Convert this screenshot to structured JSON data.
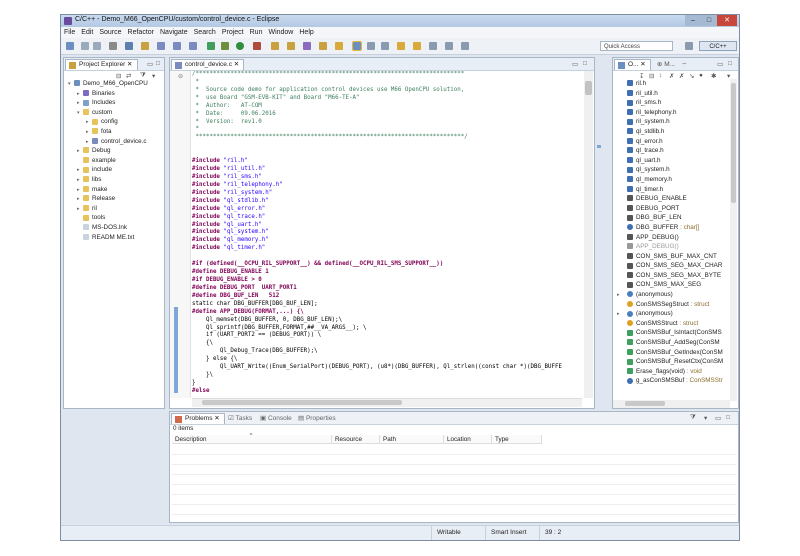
{
  "window": {
    "title": "C/C++ - Demo_M66_OpenCPU/custom/control_device.c - Eclipse"
  },
  "menu": [
    "File",
    "Edit",
    "Source",
    "Refactor",
    "Navigate",
    "Search",
    "Project",
    "Run",
    "Window",
    "Help"
  ],
  "toolbar": {
    "quick_access_placeholder": "Quick Access",
    "perspective_label": "C/C++"
  },
  "project_explorer": {
    "tab_label": "Project Explorer",
    "items": [
      {
        "label": "Demo_M66_OpenCPU",
        "depth": 0,
        "arrow": "▾",
        "icon": "project-icon",
        "color": "#6b8fbf"
      },
      {
        "label": "Binaries",
        "depth": 1,
        "arrow": "▸",
        "icon": "binaries-icon",
        "color": "#7c6bbf"
      },
      {
        "label": "Includes",
        "depth": 1,
        "arrow": "▸",
        "icon": "includes-icon",
        "color": "#7ea1c9"
      },
      {
        "label": "custom",
        "depth": 1,
        "arrow": "▾",
        "icon": "folder-icon",
        "color": "#e8c25a"
      },
      {
        "label": "config",
        "depth": 2,
        "arrow": "▸",
        "icon": "folder-icon",
        "color": "#e8c25a"
      },
      {
        "label": "fota",
        "depth": 2,
        "arrow": "▸",
        "icon": "folder-icon",
        "color": "#e8c25a"
      },
      {
        "label": "control_device.c",
        "depth": 2,
        "arrow": "▸",
        "icon": "c-file-icon",
        "color": "#7c8bbf"
      },
      {
        "label": "Debug",
        "depth": 1,
        "arrow": "▸",
        "icon": "folder-icon",
        "color": "#e8c25a"
      },
      {
        "label": "example",
        "depth": 1,
        "arrow": "",
        "icon": "folder-icon",
        "color": "#e8c25a"
      },
      {
        "label": "include",
        "depth": 1,
        "arrow": "▸",
        "icon": "folder-icon",
        "color": "#e8c25a"
      },
      {
        "label": "libs",
        "depth": 1,
        "arrow": "▸",
        "icon": "folder-icon",
        "color": "#e8c25a"
      },
      {
        "label": "make",
        "depth": 1,
        "arrow": "▸",
        "icon": "folder-icon",
        "color": "#e8c25a"
      },
      {
        "label": "Release",
        "depth": 1,
        "arrow": "▸",
        "icon": "folder-icon",
        "color": "#e8c25a"
      },
      {
        "label": "ril",
        "depth": 1,
        "arrow": "▸",
        "icon": "folder-icon",
        "color": "#e8c25a"
      },
      {
        "label": "tools",
        "depth": 1,
        "arrow": "",
        "icon": "folder-icon",
        "color": "#e8c25a"
      },
      {
        "label": "MS-DOS.lnk",
        "depth": 1,
        "arrow": "",
        "icon": "file-icon",
        "color": "#c9d3df"
      },
      {
        "label": "READM ME.txt",
        "depth": 1,
        "arrow": "",
        "icon": "text-file-icon",
        "color": "#c9d3df"
      }
    ]
  },
  "editor": {
    "tab_label": "control_device.c",
    "lines": [
      {
        "t": "cmt",
        "s": "/*****************************************************************************"
      },
      {
        "t": "cmt",
        "s": " *"
      },
      {
        "t": "cmt",
        "s": " *  Source code demo for application control devices use M66 OpenCPU solution,"
      },
      {
        "t": "cmt",
        "s": " *  use Board \"GSM-EVB-KIT\" and Board \"M66-TE-A\""
      },
      {
        "t": "cmt",
        "s": " *  Author:   AT-COM"
      },
      {
        "t": "cmt",
        "s": " *  Date:     09.06.2016"
      },
      {
        "t": "cmt",
        "s": " *  Version:  rev1.0"
      },
      {
        "t": "cmt",
        "s": " *"
      },
      {
        "t": "cmt",
        "s": " *****************************************************************************/"
      },
      {
        "t": "txt",
        "s": ""
      },
      {
        "t": "txt",
        "s": ""
      },
      {
        "t": "inc",
        "p": "#include ",
        "s": "\"ril.h\""
      },
      {
        "t": "inc",
        "p": "#include ",
        "s": "\"ril_util.h\""
      },
      {
        "t": "inc",
        "p": "#include ",
        "s": "\"ril_sms.h\""
      },
      {
        "t": "inc",
        "p": "#include ",
        "s": "\"ril_telephony.h\""
      },
      {
        "t": "inc",
        "p": "#include ",
        "s": "\"ril_system.h\""
      },
      {
        "t": "inc",
        "p": "#include ",
        "s": "\"ql_stdlib.h\""
      },
      {
        "t": "inc",
        "p": "#include ",
        "s": "\"ql_error.h\""
      },
      {
        "t": "inc",
        "p": "#include ",
        "s": "\"ql_trace.h\""
      },
      {
        "t": "inc",
        "p": "#include ",
        "s": "\"ql_uart.h\""
      },
      {
        "t": "inc",
        "p": "#include ",
        "s": "\"ql_system.h\""
      },
      {
        "t": "inc",
        "p": "#include ",
        "s": "\"ql_memory.h\""
      },
      {
        "t": "inc",
        "p": "#include ",
        "s": "\"ql_timer.h\""
      },
      {
        "t": "txt",
        "s": ""
      },
      {
        "t": "pre",
        "s": "#if (defined(__OCPU_RIL_SUPPORT__) && defined(__OCPU_RIL_SMS_SUPPORT__))"
      },
      {
        "t": "pre",
        "s": "#define DEBUG_ENABLE 1"
      },
      {
        "t": "pre",
        "s": "#if DEBUG_ENABLE > 0"
      },
      {
        "t": "pre",
        "s": "#define DEBUG_PORT  UART_PORT1"
      },
      {
        "t": "pre",
        "s": "#define DBG_BUF_LEN   512"
      },
      {
        "t": "txt",
        "s": "static char DBG_BUFFER[DBG_BUF_LEN];"
      },
      {
        "t": "pre",
        "s": "#define APP_DEBUG(FORMAT,...) {\\"
      },
      {
        "t": "txt",
        "s": "    Ql_memset(DBG_BUFFER, 0, DBG_BUF_LEN);\\"
      },
      {
        "t": "txt",
        "s": "    Ql_sprintf(DBG_BUFFER,FORMAT,##__VA_ARGS__); \\"
      },
      {
        "t": "txt",
        "s": "    if (UART_PORT2 == (DEBUG_PORT)) \\"
      },
      {
        "t": "txt",
        "s": "    {\\"
      },
      {
        "t": "txt",
        "s": "        Ql_Debug_Trace(DBG_BUFFER);\\"
      },
      {
        "t": "txt",
        "s": "    } else {\\"
      },
      {
        "t": "txt",
        "s": "        Ql_UART_Write((Enum_SerialPort)(DEBUG_PORT), (u8*)(DBG_BUFFER), Ql_strlen((const char *)(DBG_BUFFE"
      },
      {
        "t": "txt",
        "s": "    }\\"
      },
      {
        "t": "txt",
        "s": "}"
      },
      {
        "t": "pre",
        "s": "#else"
      }
    ]
  },
  "outline": {
    "tab1": "O...",
    "tab2": "M...",
    "items": [
      {
        "label": "ril.h",
        "icon": "include-icon",
        "color": "#3f6fb0"
      },
      {
        "label": "ril_util.h",
        "icon": "include-icon",
        "color": "#3f6fb0"
      },
      {
        "label": "ril_sms.h",
        "icon": "include-icon",
        "color": "#3f6fb0"
      },
      {
        "label": "ril_telephony.h",
        "icon": "include-icon",
        "color": "#3f6fb0"
      },
      {
        "label": "ril_system.h",
        "icon": "include-icon",
        "color": "#3f6fb0"
      },
      {
        "label": "ql_stdlib.h",
        "icon": "include-icon",
        "color": "#3f6fb0"
      },
      {
        "label": "ql_error.h",
        "icon": "include-icon",
        "color": "#3f6fb0"
      },
      {
        "label": "ql_trace.h",
        "icon": "include-icon",
        "color": "#3f6fb0"
      },
      {
        "label": "ql_uart.h",
        "icon": "include-icon",
        "color": "#3f6fb0"
      },
      {
        "label": "ql_system.h",
        "icon": "include-icon",
        "color": "#3f6fb0"
      },
      {
        "label": "ql_memory.h",
        "icon": "include-icon",
        "color": "#3f6fb0"
      },
      {
        "label": "ql_timer.h",
        "icon": "include-icon",
        "color": "#3f6fb0"
      },
      {
        "label": "DEBUG_ENABLE",
        "icon": "macro-icon",
        "color": "#555555"
      },
      {
        "label": "DEBUG_PORT",
        "icon": "macro-icon",
        "color": "#555555"
      },
      {
        "label": "DBG_BUF_LEN",
        "icon": "macro-icon",
        "color": "#555555"
      },
      {
        "label": "DBG_BUFFER",
        "extra": " : char[]",
        "icon": "variable-icon",
        "color": "#3f6fb0"
      },
      {
        "label": "APP_DEBUG()",
        "icon": "macro-icon",
        "color": "#555555"
      },
      {
        "label": "APP_DEBUG()",
        "icon": "macro-icon",
        "color": "#999999",
        "dim": true
      },
      {
        "label": "CON_SMS_BUF_MAX_CNT",
        "icon": "macro-icon",
        "color": "#555555"
      },
      {
        "label": "CON_SMS_SEG_MAX_CHAR",
        "icon": "macro-icon",
        "color": "#555555"
      },
      {
        "label": "CON_SMS_SEG_MAX_BYTE",
        "icon": "macro-icon",
        "color": "#555555"
      },
      {
        "label": "CON_SMS_MAX_SEG",
        "icon": "macro-icon",
        "color": "#555555"
      },
      {
        "label": "(anonymous)",
        "icon": "struct-icon",
        "color": "#4a7fbf",
        "arrow": "▸"
      },
      {
        "label": "ConSMSSegStruct",
        "extra": " : struct",
        "icon": "typedef-icon",
        "color": "#e0a020"
      },
      {
        "label": "(anonymous)",
        "icon": "struct-icon",
        "color": "#4a7fbf",
        "arrow": "▸"
      },
      {
        "label": "ConSMSStruct",
        "extra": " : struct",
        "icon": "typedef-icon",
        "color": "#e0a020"
      },
      {
        "label": "ConSMSBuf_IsIntact(ConSMS",
        "icon": "function-icon",
        "color": "#3f9f5f"
      },
      {
        "label": "ConSMSBuf_AddSeg(ConSM",
        "icon": "function-icon",
        "color": "#3f9f5f"
      },
      {
        "label": "ConSMSBuf_GetIndex(ConSM",
        "icon": "function-icon",
        "color": "#3f9f5f"
      },
      {
        "label": "ConSMSBuf_ResetCtx(ConSM",
        "icon": "function-icon",
        "color": "#3f9f5f"
      },
      {
        "label": "Erase_flags(void)",
        "extra": " : void",
        "icon": "function-icon",
        "color": "#3f9f5f"
      },
      {
        "label": "g_asConSMSBuf",
        "extra": " : ConSMSStr",
        "icon": "variable-icon",
        "color": "#3f6fb0"
      }
    ]
  },
  "problems": {
    "tabs": [
      "Problems",
      "Tasks",
      "Console",
      "Properties"
    ],
    "count_label": "0 items",
    "columns": [
      "Description",
      "Resource",
      "Path",
      "Location",
      "Type"
    ]
  },
  "statusbar": {
    "writable": "Writable",
    "insert_mode": "Smart Insert",
    "position": "39 : 2"
  }
}
